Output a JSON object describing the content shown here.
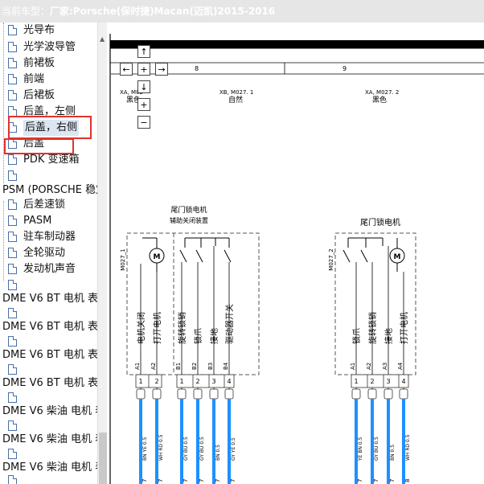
{
  "header": {
    "prefix": "当前车型：",
    "model": "厂家:Porsche(保时捷)Macan(迈凯)2015-2016"
  },
  "tree": {
    "items": [
      {
        "label": "光导布"
      },
      {
        "label": "光学波导管"
      },
      {
        "label": "前裙板"
      },
      {
        "label": "前端"
      },
      {
        "label": "后裙板"
      },
      {
        "label": "后盖，左侧"
      },
      {
        "label": "后盖，右侧"
      },
      {
        "label": "后盖"
      },
      {
        "label": "PDK 变速箱"
      },
      {
        "label": ""
      },
      {
        "label": "PSM (PORSCHE 稳定"
      },
      {
        "label": "后差速锁"
      },
      {
        "label": "PASM"
      },
      {
        "label": "驻车制动器"
      },
      {
        "label": "全轮驱动"
      },
      {
        "label": "发动机声音"
      },
      {
        "label": ""
      },
      {
        "label": "DME V6 BT 电机 表"
      },
      {
        "label": "DME V6 BT 电机 表"
      },
      {
        "label": "DME V6 BT 电机 表"
      },
      {
        "label": "DME V6 BT 电机 表"
      },
      {
        "label": "DME V6 柴油 电机 表"
      },
      {
        "label": "DME V6 柴油 电机 表"
      },
      {
        "label": "DME V6 柴油 电机 表"
      }
    ]
  },
  "nav": {
    "up": "↑",
    "down": "↓",
    "left": "←",
    "right": "→",
    "center": "+",
    "zoom_in": "+",
    "zoom_out": "−"
  },
  "diagram": {
    "grid_8": "8",
    "grid_9": "9",
    "conn_a_id": "XA, M02",
    "conn_a_color": "黑色",
    "conn_b_id": "XB, M027. 1",
    "conn_b_color": "自然",
    "conn_c_id": "XA, M027. 2",
    "conn_c_color": "黑色",
    "motor1_title_1": "尾门锁电机",
    "motor1_title_2": "辅助关闭装置",
    "motor2_title": "尾门锁电机",
    "motor1_ref": "M027_1",
    "motor2_ref": "M027_2",
    "m1_pins": [
      {
        "pin": "A1",
        "num": "1",
        "func": "电机关闭",
        "wire": "BN YE 0.5",
        "cnum": "7"
      },
      {
        "pin": "A2",
        "num": "2",
        "func": "打开电机",
        "wire": "WH RD 0.5",
        "cnum": "7"
      }
    ],
    "m1_pins_b": [
      {
        "pin": "B1",
        "num": "1",
        "func": "旋转锁销",
        "wire": "GY BU 0.5",
        "cnum": "7"
      },
      {
        "pin": "B2",
        "num": "2",
        "func": "锁爪",
        "wire": "GY BU 0.5",
        "cnum": "7"
      },
      {
        "pin": "B3",
        "num": "3",
        "func": "接地",
        "wire": "BN 0.5",
        "cnum": "7"
      },
      {
        "pin": "B4",
        "num": "4",
        "func": "驱动器开关",
        "wire": "GY YE 0.5",
        "cnum": "7"
      }
    ],
    "m2_pins": [
      {
        "pin": "A1",
        "num": "1",
        "func": "锁爪",
        "wire": "YE BN 0.5",
        "cnum": "7"
      },
      {
        "pin": "A2",
        "num": "2",
        "func": "旋转锁销",
        "wire": "GY BU 0.5",
        "cnum": "7"
      },
      {
        "pin": "A3",
        "num": "3",
        "func": "接地",
        "wire": "BN 0.5",
        "cnum": "7"
      },
      {
        "pin": "A4",
        "num": "4",
        "func": "打开电机",
        "wire": "WH RD 0.5",
        "cnum": "8"
      }
    ]
  }
}
